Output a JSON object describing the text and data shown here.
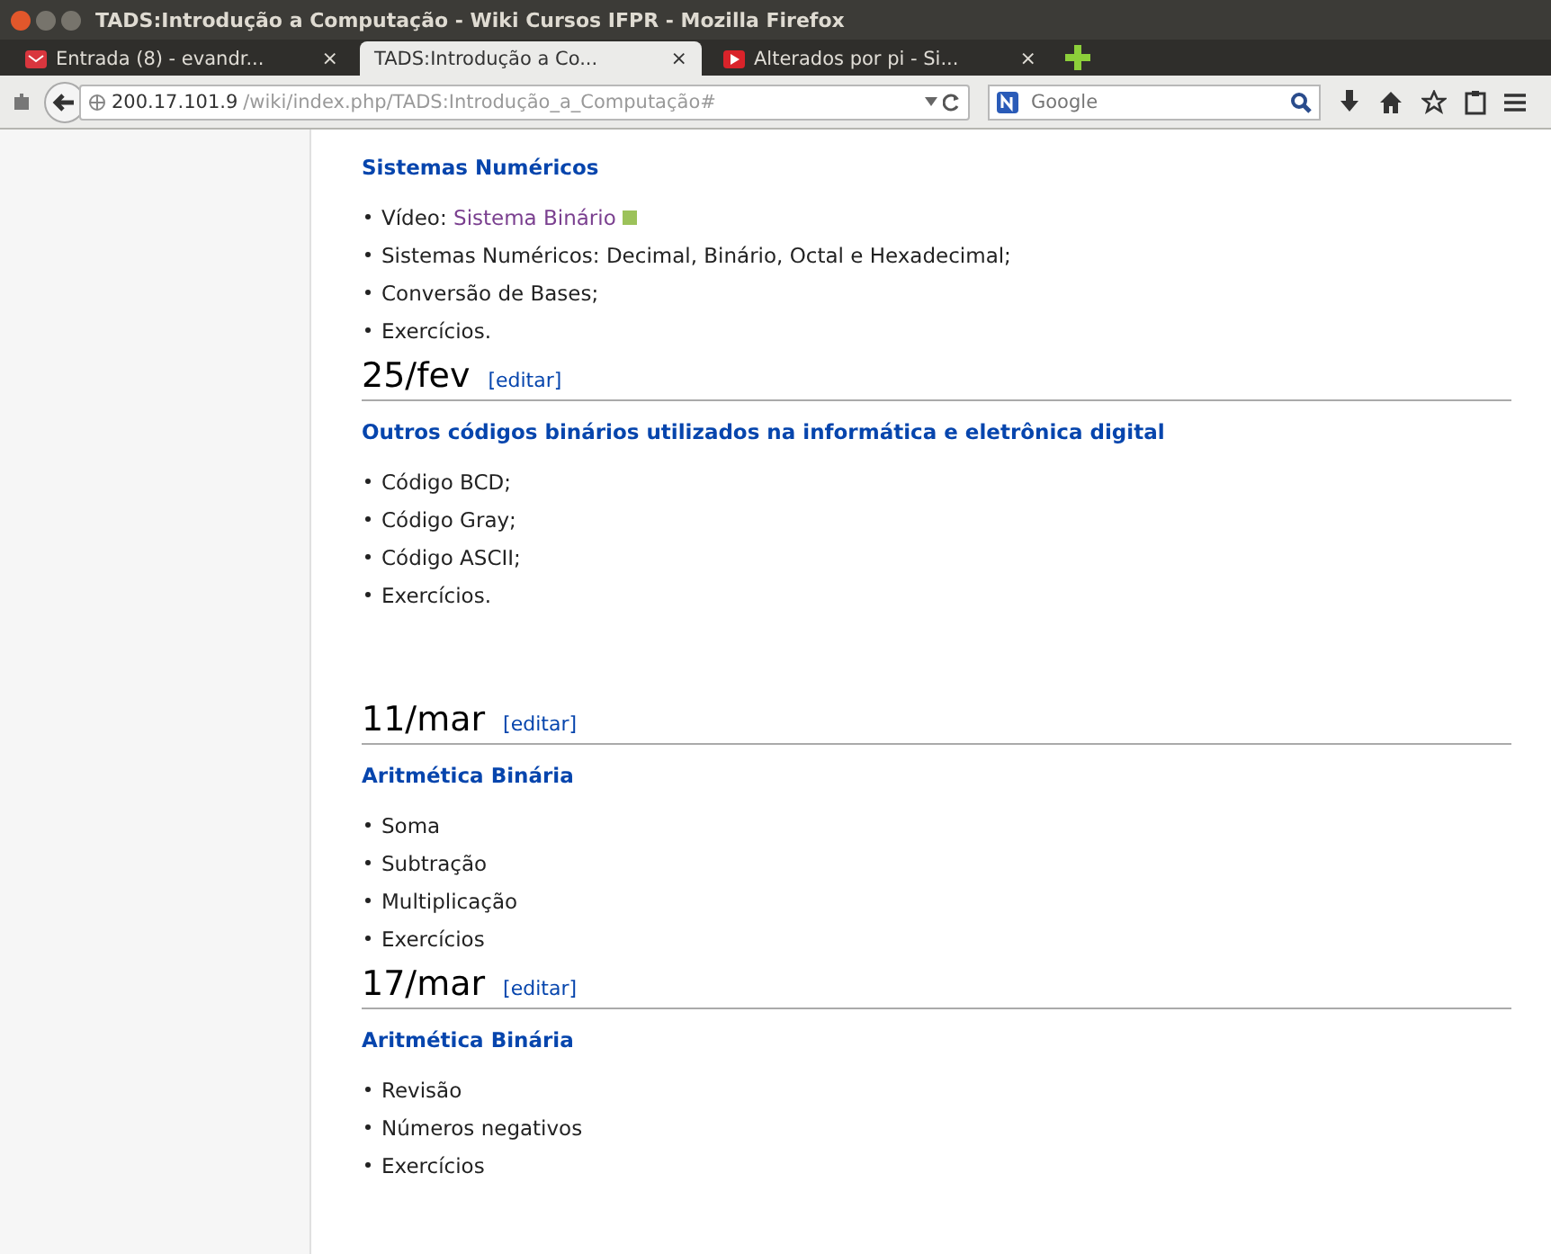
{
  "window": {
    "title": "TADS:Introdução a Computação - Wiki Cursos IFPR - Mozilla Firefox"
  },
  "tabs": [
    {
      "label": "Entrada (8) - evandr...",
      "close": "×",
      "kind": "mail",
      "selected": false
    },
    {
      "label": "TADS:Introdução a Co...",
      "close": "×",
      "kind": "page",
      "selected": true
    },
    {
      "label": "Alterados por pi - Si...",
      "close": "×",
      "kind": "video",
      "selected": false
    }
  ],
  "url": {
    "host": "200.17.101.9",
    "path": "/wiki/index.php/TADS:Introdução_a_Computação#"
  },
  "search": {
    "placeholder": "Google"
  },
  "content": [
    {
      "kind": "subheading",
      "text": "Sistemas Numéricos"
    },
    {
      "kind": "list",
      "items": [
        {
          "text": "Vídeo: ",
          "link": "Sistema Binário"
        },
        {
          "text": "Sistemas Numéricos: Decimal, Binário, Octal e Hexadecimal;"
        },
        {
          "text": "Conversão de Bases;"
        },
        {
          "text": "Exercícios."
        }
      ]
    },
    {
      "kind": "date",
      "text": "25/fev",
      "edit": "[editar]"
    },
    {
      "kind": "subheading",
      "text": "Outros códigos binários utilizados na informática e eletrônica digital"
    },
    {
      "kind": "list",
      "items": [
        {
          "text": "Código BCD;"
        },
        {
          "text": "Código Gray;"
        },
        {
          "text": "Código ASCII;"
        },
        {
          "text": "Exercícios."
        }
      ]
    },
    {
      "kind": "spacer"
    },
    {
      "kind": "date",
      "text": "11/mar",
      "edit": "[editar]"
    },
    {
      "kind": "subheading",
      "text": "Aritmética Binária"
    },
    {
      "kind": "list",
      "items": [
        {
          "text": "Soma"
        },
        {
          "text": "Subtração"
        },
        {
          "text": "Multiplicação"
        },
        {
          "text": "Exercícios"
        }
      ]
    },
    {
      "kind": "date",
      "text": "17/mar",
      "edit": "[editar]"
    },
    {
      "kind": "subheading",
      "text": "Aritmética Binária"
    },
    {
      "kind": "list",
      "items": [
        {
          "text": "Revisão"
        },
        {
          "text": "Números negativos"
        },
        {
          "text": "Exercícios"
        }
      ]
    }
  ]
}
